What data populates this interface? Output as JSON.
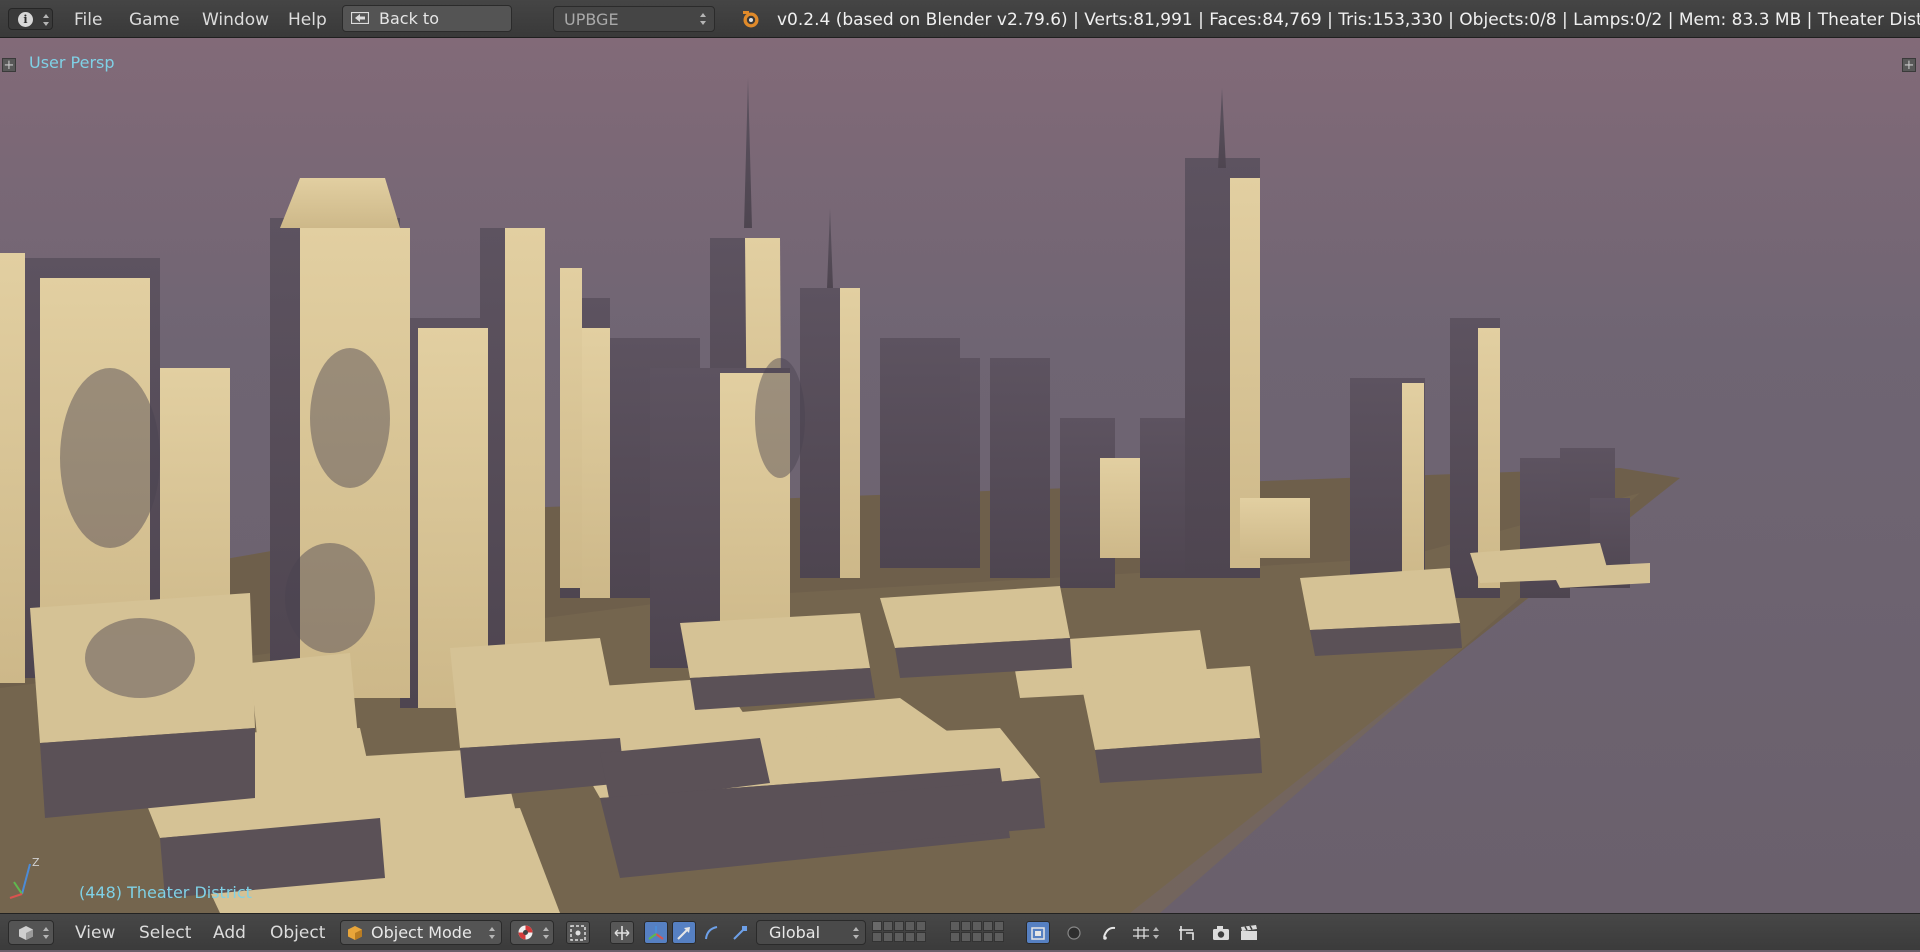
{
  "header": {
    "editor_type_icon": "info-icon",
    "menu": [
      "File",
      "Game",
      "Window",
      "Help"
    ],
    "back_button_label": "Back to Previous",
    "engine": "UPBGE",
    "stats": "v0.2.4 (based on Blender v2.79.6)  | Verts:81,991 | Faces:84,769 | Tris:153,330 | Objects:0/8 | Lamps:0/2 | Mem: 83.3 MB | Theater Dist.."
  },
  "viewport": {
    "view_label": "User Persp",
    "object_label": "(448) Theater District",
    "axis_label": "Z"
  },
  "footer": {
    "menu": [
      "View",
      "Select",
      "Add",
      "Object"
    ],
    "mode": "Object Mode",
    "transform_orientation": "Global",
    "icons": [
      "cube-icon",
      "manipulator-icon",
      "snap-icon",
      "cursor-icon",
      "arrow-icon",
      "rotate-icon",
      "scale-icon",
      "layers",
      "lock-icon",
      "render-icon",
      "camera-icon",
      "clapper-icon"
    ]
  },
  "colors": {
    "header_bg": "#3e3e3e",
    "accent_blue": "#5680c2",
    "label_cyan": "#7fd1e6",
    "building_lit": "#d9c79b",
    "building_shadow": "#5a5058",
    "sky": "#6e6572"
  }
}
